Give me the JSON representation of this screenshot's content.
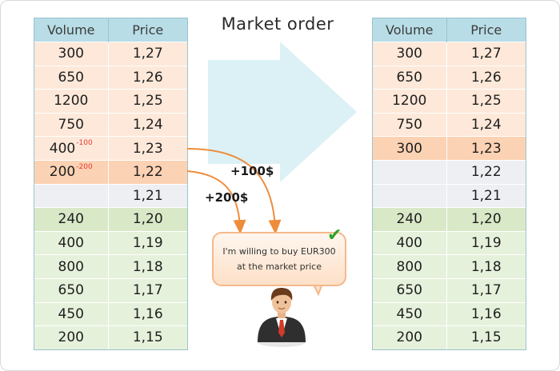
{
  "title": "Market order",
  "headers": {
    "volume": "Volume",
    "price": "Price"
  },
  "left_book": {
    "asks": [
      {
        "volume": "300",
        "price": "1,27"
      },
      {
        "volume": "650",
        "price": "1,26"
      },
      {
        "volume": "1200",
        "price": "1,25"
      },
      {
        "volume": "750",
        "price": "1,24"
      },
      {
        "volume": "400",
        "delta": "-100",
        "price": "1,23"
      },
      {
        "volume": "200",
        "delta": "-200",
        "price": "1,22"
      },
      {
        "volume": "",
        "price": "1,21"
      }
    ],
    "bids": [
      {
        "volume": "240",
        "price": "1,20"
      },
      {
        "volume": "400",
        "price": "1,19"
      },
      {
        "volume": "800",
        "price": "1,18"
      },
      {
        "volume": "650",
        "price": "1,17"
      },
      {
        "volume": "450",
        "price": "1,16"
      },
      {
        "volume": "200",
        "price": "1,15"
      }
    ]
  },
  "right_book": {
    "asks": [
      {
        "volume": "300",
        "price": "1,27"
      },
      {
        "volume": "650",
        "price": "1,26"
      },
      {
        "volume": "1200",
        "price": "1,25"
      },
      {
        "volume": "750",
        "price": "1,24"
      },
      {
        "volume": "300",
        "price": "1,23"
      },
      {
        "volume": "",
        "price": "1,22"
      },
      {
        "volume": "",
        "price": "1,21"
      }
    ],
    "bids": [
      {
        "volume": "240",
        "price": "1,20"
      },
      {
        "volume": "400",
        "price": "1,19"
      },
      {
        "volume": "800",
        "price": "1,18"
      },
      {
        "volume": "650",
        "price": "1,17"
      },
      {
        "volume": "450",
        "price": "1,16"
      },
      {
        "volume": "200",
        "price": "1,15"
      }
    ]
  },
  "fills": {
    "first": "+100$",
    "second": "+200$"
  },
  "bubble": {
    "line1": "I'm willing to buy EUR300",
    "line2": "at the market price"
  },
  "icons": [
    "big-right-arrow-icon",
    "checkmark-icon",
    "trader-avatar-icon"
  ],
  "colors": {
    "header": "#b8dde6",
    "ask": "#fde8d9",
    "highlight": "#fbd2b3",
    "empty": "#eeeff2",
    "best_bid": "#d9e8c7",
    "bid": "#e6f1dc",
    "arrow": "#ef8c3a",
    "check": "#2ea02a"
  }
}
